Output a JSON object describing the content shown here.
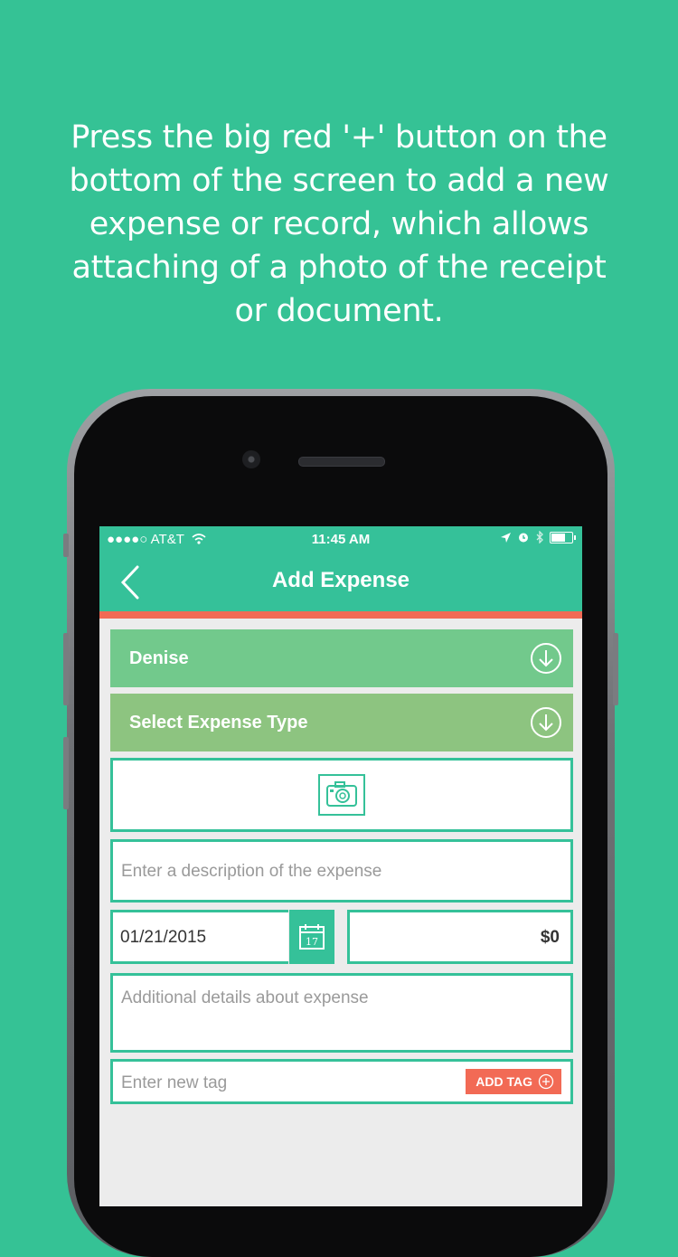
{
  "caption": "Press the big red '+' button on the bottom of the screen to add a new expense or record, which allows attaching of a photo of the receipt or document.",
  "status_bar": {
    "carrier": "●●●●○ AT&T",
    "time": "11:45 AM"
  },
  "nav": {
    "title": "Add Expense"
  },
  "form": {
    "person": "Denise",
    "expense_type": "Select Expense Type",
    "description_placeholder": "Enter a description of the expense",
    "date": "01/21/2015",
    "calendar_day": "17",
    "amount": "$0",
    "details_placeholder": "Additional details about expense",
    "tag_placeholder": "Enter new tag",
    "add_tag_label": "ADD TAG"
  },
  "colors": {
    "background": "#35c295",
    "primary": "#35c199",
    "accent": "#f26a55",
    "person_row": "#72c98c",
    "type_row": "#8dc480"
  },
  "icons": [
    "back-chevron-icon",
    "chevron-down-circle-icon",
    "camera-icon",
    "calendar-icon",
    "plus-circle-icon",
    "wifi-icon",
    "location-icon",
    "alarm-icon",
    "bluetooth-icon",
    "battery-icon"
  ]
}
